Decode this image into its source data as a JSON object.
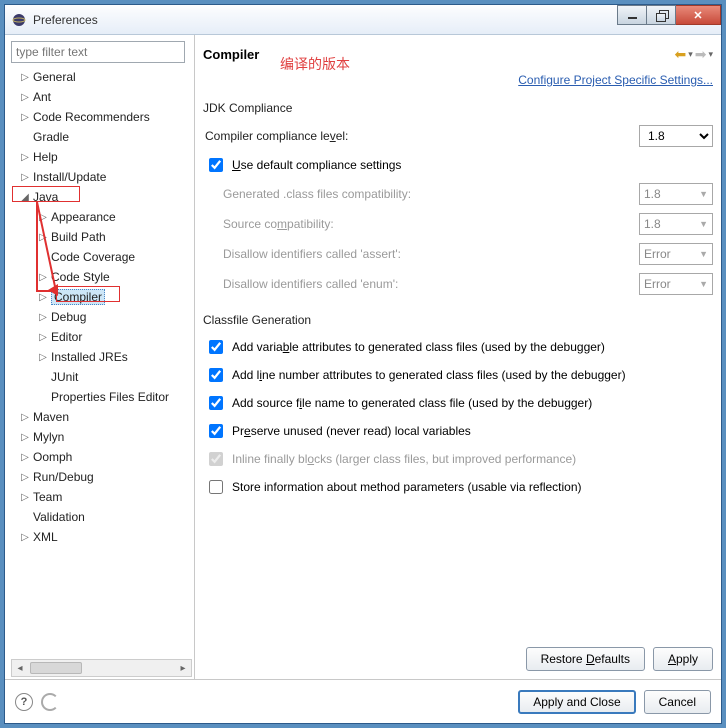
{
  "window": {
    "title": "Preferences"
  },
  "annotation": "编译的版本",
  "sidebar": {
    "filter_placeholder": "type filter text",
    "nodes": [
      {
        "label": "General",
        "depth": 0,
        "tw": "▷"
      },
      {
        "label": "Ant",
        "depth": 0,
        "tw": "▷"
      },
      {
        "label": "Code Recommenders",
        "depth": 0,
        "tw": "▷"
      },
      {
        "label": "Gradle",
        "depth": 0,
        "tw": ""
      },
      {
        "label": "Help",
        "depth": 0,
        "tw": "▷"
      },
      {
        "label": "Install/Update",
        "depth": 0,
        "tw": "▷"
      },
      {
        "label": "Java",
        "depth": 0,
        "tw": "◢"
      },
      {
        "label": "Appearance",
        "depth": 1,
        "tw": "▷"
      },
      {
        "label": "Build Path",
        "depth": 1,
        "tw": "▷"
      },
      {
        "label": "Code Coverage",
        "depth": 1,
        "tw": ""
      },
      {
        "label": "Code Style",
        "depth": 1,
        "tw": "▷"
      },
      {
        "label": "Compiler",
        "depth": 1,
        "tw": "▷",
        "selected": true
      },
      {
        "label": "Debug",
        "depth": 1,
        "tw": "▷"
      },
      {
        "label": "Editor",
        "depth": 1,
        "tw": "▷"
      },
      {
        "label": "Installed JREs",
        "depth": 1,
        "tw": "▷"
      },
      {
        "label": "JUnit",
        "depth": 1,
        "tw": ""
      },
      {
        "label": "Properties Files Editor",
        "depth": 1,
        "tw": ""
      },
      {
        "label": "Maven",
        "depth": 0,
        "tw": "▷"
      },
      {
        "label": "Mylyn",
        "depth": 0,
        "tw": "▷"
      },
      {
        "label": "Oomph",
        "depth": 0,
        "tw": "▷"
      },
      {
        "label": "Run/Debug",
        "depth": 0,
        "tw": "▷"
      },
      {
        "label": "Team",
        "depth": 0,
        "tw": "▷"
      },
      {
        "label": "Validation",
        "depth": 0,
        "tw": ""
      },
      {
        "label": "XML",
        "depth": 0,
        "tw": "▷"
      }
    ]
  },
  "main": {
    "heading": "Compiler",
    "configure_link": "Configure Project Specific Settings...",
    "section_compliance": "JDK Compliance",
    "compliance_label": "Compiler compliance level:",
    "compliance_value": "1.8",
    "use_default_label": "Use default compliance settings",
    "gen_class_label": "Generated .class files compatibility:",
    "gen_class_value": "1.8",
    "source_compat_label": "Source compatibility:",
    "source_compat_value": "1.8",
    "disallow_assert_label": "Disallow identifiers called 'assert':",
    "disallow_assert_value": "Error",
    "disallow_enum_label": "Disallow identifiers called 'enum':",
    "disallow_enum_value": "Error",
    "section_classfile": "Classfile Generation",
    "cg1": "Add variable attributes to generated class files (used by the debugger)",
    "cg2": "Add line number attributes to generated class files (used by the debugger)",
    "cg3": "Add source file name to generated class file (used by the debugger)",
    "cg4": "Preserve unused (never read) local variables",
    "cg5": "Inline finally blocks (larger class files, but improved performance)",
    "cg6": "Store information about method parameters (usable via reflection)",
    "restore_btn": "Restore Defaults",
    "apply_btn": "Apply"
  },
  "footer": {
    "apply_close": "Apply and Close",
    "cancel": "Cancel"
  }
}
